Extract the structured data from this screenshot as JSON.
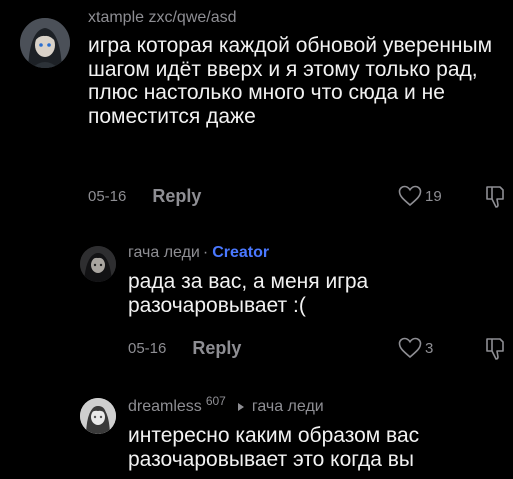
{
  "colors": {
    "background": "#000000",
    "text": "#f2f2f2",
    "muted": "#8e8e93",
    "creator_badge": "#4a78ff"
  },
  "comments": [
    {
      "username": "xtample zxc/qwe/asd",
      "text": "игра которая каждой обновой уверенным шагом идёт вверх и я этому только рад, плюс настолько много что сюда и не поместится даже",
      "date": "05-16",
      "reply_label": "Reply",
      "likes": "19",
      "avatar_icon": "anime-girl-avatar"
    },
    {
      "username": "гача леди",
      "separator": "·",
      "badge": "Creator",
      "text": "рада за вас, а меня игра разочаровывает :(",
      "date": "05-16",
      "reply_label": "Reply",
      "likes": "3",
      "avatar_icon": "dark-character-avatar"
    },
    {
      "username": "dreamless",
      "user_count": "607",
      "reply_to": "гача леди",
      "text": "интересно каким образом вас разочаровывает это когда вы",
      "avatar_icon": "sketch-character-avatar"
    }
  ]
}
